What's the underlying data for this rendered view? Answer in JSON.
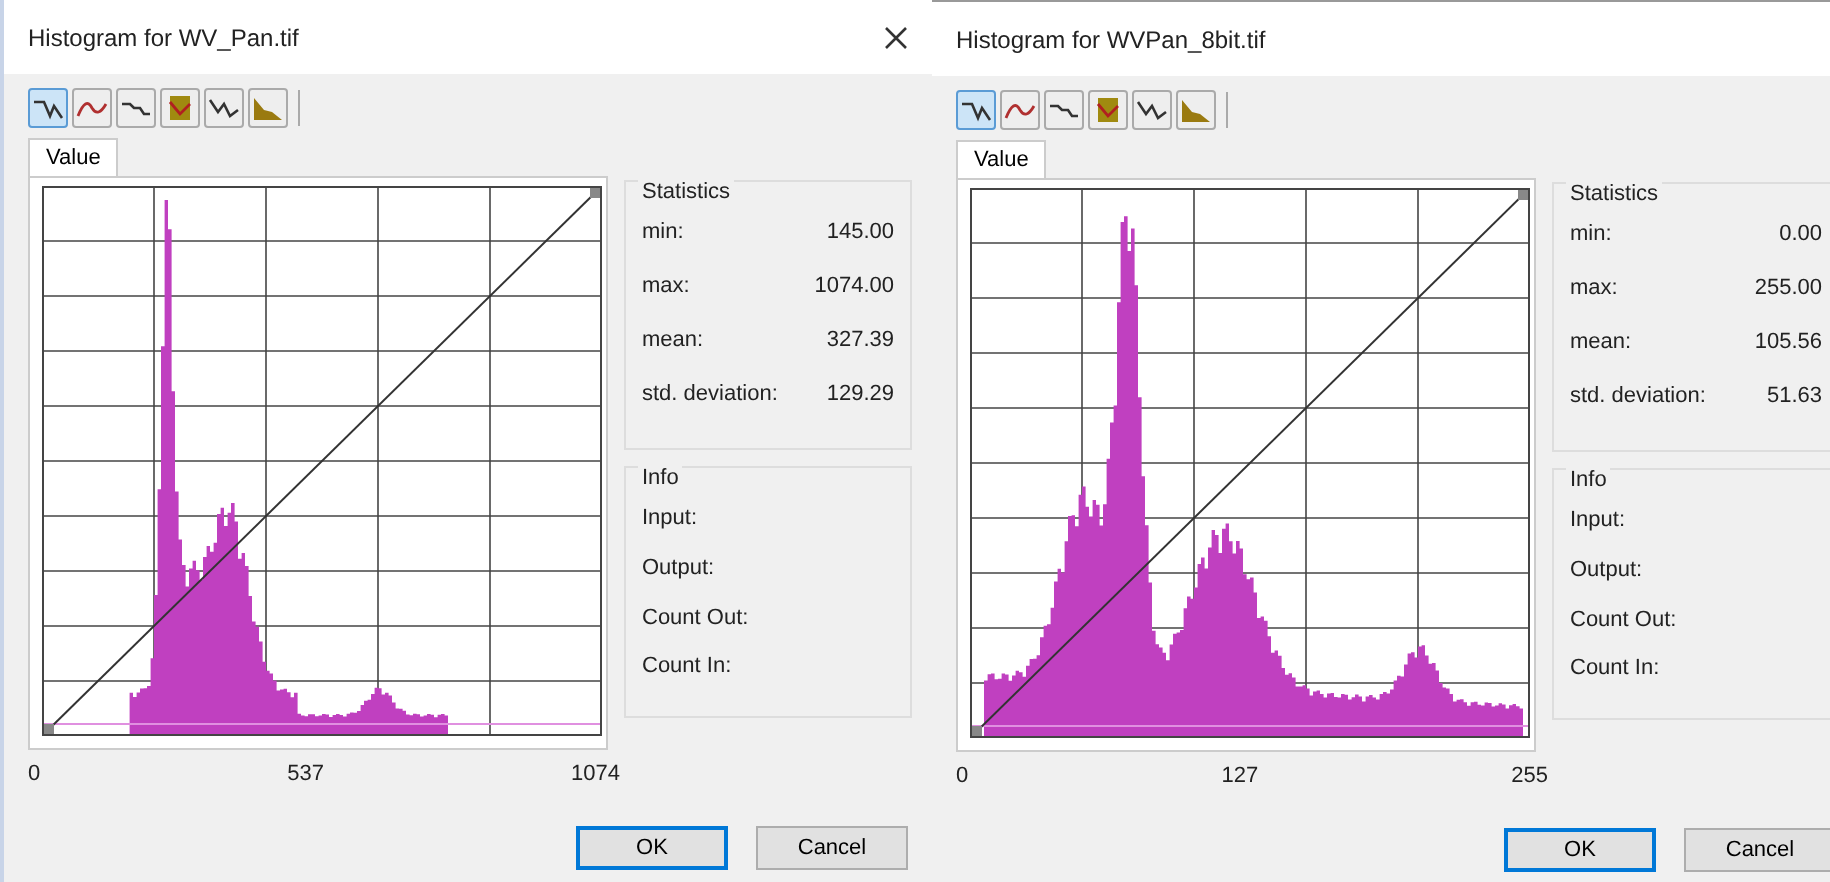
{
  "dialogs": [
    {
      "title": "Histogram for WV_Pan.tif",
      "tools": [
        {
          "kind": "linear",
          "selected": true
        },
        {
          "kind": "curve",
          "selected": false
        },
        {
          "kind": "step",
          "selected": false
        },
        {
          "kind": "equalize",
          "selected": false
        },
        {
          "kind": "points",
          "selected": false
        },
        {
          "kind": "area",
          "selected": false
        }
      ],
      "tabs": [
        {
          "label": "Value",
          "selected": true
        }
      ],
      "statistics": {
        "title": "Statistics",
        "rows": [
          {
            "label": "min:",
            "value": "145.00"
          },
          {
            "label": "max:",
            "value": "1074.00"
          },
          {
            "label": "mean:",
            "value": "327.39"
          },
          {
            "label": "std. deviation:",
            "value": "129.29"
          }
        ]
      },
      "info": {
        "title": "Info",
        "rows": [
          "Input:",
          "Output:",
          "Count Out:",
          "Count In:"
        ]
      },
      "axis_labels": [
        "0",
        "537",
        "1074"
      ],
      "buttons": [
        {
          "label": "OK",
          "default": true
        },
        {
          "label": "Cancel",
          "default": false
        }
      ]
    },
    {
      "title": "Histogram for WVPan_8bit.tif",
      "tools": [
        {
          "kind": "linear",
          "selected": true
        },
        {
          "kind": "curve",
          "selected": false
        },
        {
          "kind": "step",
          "selected": false
        },
        {
          "kind": "equalize",
          "selected": false
        },
        {
          "kind": "points",
          "selected": false
        },
        {
          "kind": "area",
          "selected": false
        }
      ],
      "tabs": [
        {
          "label": "Value",
          "selected": true
        }
      ],
      "statistics": {
        "title": "Statistics",
        "rows": [
          {
            "label": "min:",
            "value": "0.00"
          },
          {
            "label": "max:",
            "value": "255.00"
          },
          {
            "label": "mean:",
            "value": "105.56"
          },
          {
            "label": "std. deviation:",
            "value": "51.63"
          }
        ]
      },
      "info": {
        "title": "Info",
        "rows": [
          "Input:",
          "Output:",
          "Count Out:",
          "Count In:"
        ]
      },
      "axis_labels": [
        "0",
        "127",
        "255"
      ],
      "buttons": [
        {
          "label": "OK",
          "default": true
        },
        {
          "label": "Cancel",
          "default": false
        }
      ]
    }
  ]
}
